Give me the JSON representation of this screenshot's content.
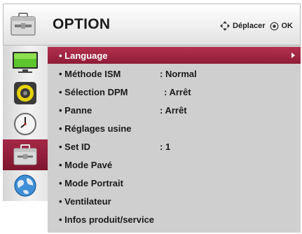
{
  "header": {
    "title": "OPTION",
    "move_label": "Déplacer",
    "ok_label": "OK"
  },
  "sidebar": {
    "items": [
      {
        "name": "picture-icon"
      },
      {
        "name": "sound-icon"
      },
      {
        "name": "time-icon"
      },
      {
        "name": "option-toolbox-icon",
        "active": true
      },
      {
        "name": "network-globe-icon"
      }
    ]
  },
  "menu": {
    "items": [
      {
        "label": "• Language",
        "value": "",
        "selected": true
      },
      {
        "label": "• Méthode ISM",
        "value": ": Normal"
      },
      {
        "label": "• Sélection DPM",
        "value": ": Arrêt"
      },
      {
        "label": "• Panne",
        "value": ": Arrêt"
      },
      {
        "label": "• Réglages usine",
        "value": ""
      },
      {
        "label": "• Set ID",
        "value": ": 1"
      },
      {
        "label": "• Mode Pavé",
        "value": ""
      },
      {
        "label": "• Mode Portrait",
        "value": ""
      },
      {
        "label": "• Ventilateur",
        "value": ""
      },
      {
        "label": "• Infos produit/service",
        "value": ""
      }
    ]
  },
  "colors": {
    "accent": "#9e2340",
    "panel": "#cfcfcf"
  }
}
